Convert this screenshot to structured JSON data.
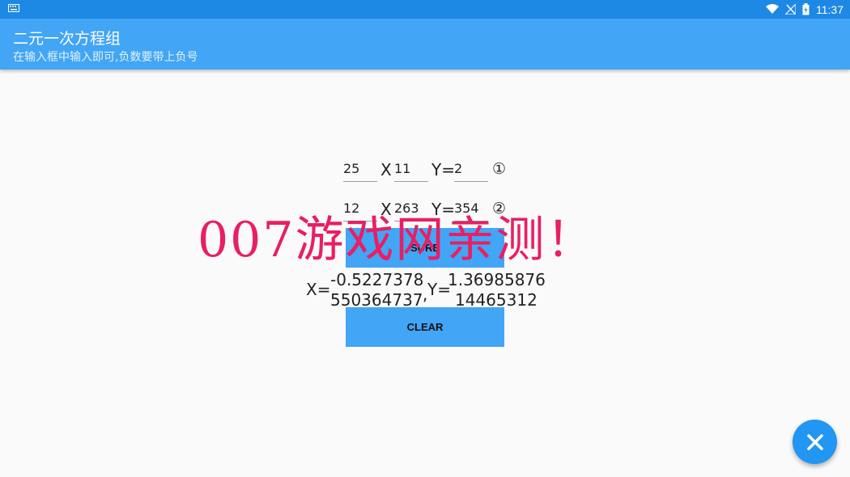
{
  "status": {
    "time": "11:37"
  },
  "appbar": {
    "title": "二元一次方程组",
    "subtitle": "在输入框中输入即可,负数要带上负号"
  },
  "equation1": {
    "a": "25",
    "x_label": "X",
    "b": "11",
    "y_label": "Y=",
    "c": "2",
    "marker": "①"
  },
  "equation2": {
    "a": "12",
    "x_label": "X",
    "b": "263",
    "y_label": "Y=",
    "c": "354",
    "marker": "②"
  },
  "buttons": {
    "sure": "SURE",
    "clear": "CLEAR"
  },
  "result": {
    "x_label": "X=",
    "x_line1": "-0.5227378",
    "x_line2": "550364737",
    "sep": ",",
    "y_label": "Y=",
    "y_line1": "1.36985876",
    "y_line2": "14465312"
  },
  "watermark": "007游戏网亲测！",
  "icons": {
    "fab": "close-icon",
    "wifi": "wifi-icon",
    "signal": "no-signal-icon",
    "battery": "battery-icon",
    "keyboard": "keyboard-icon"
  },
  "colors": {
    "statusbar": "#1e88e5",
    "appbar": "#42a5f5",
    "button": "#42a5f5",
    "fab": "#2196f3",
    "watermark": "#e91e63"
  }
}
